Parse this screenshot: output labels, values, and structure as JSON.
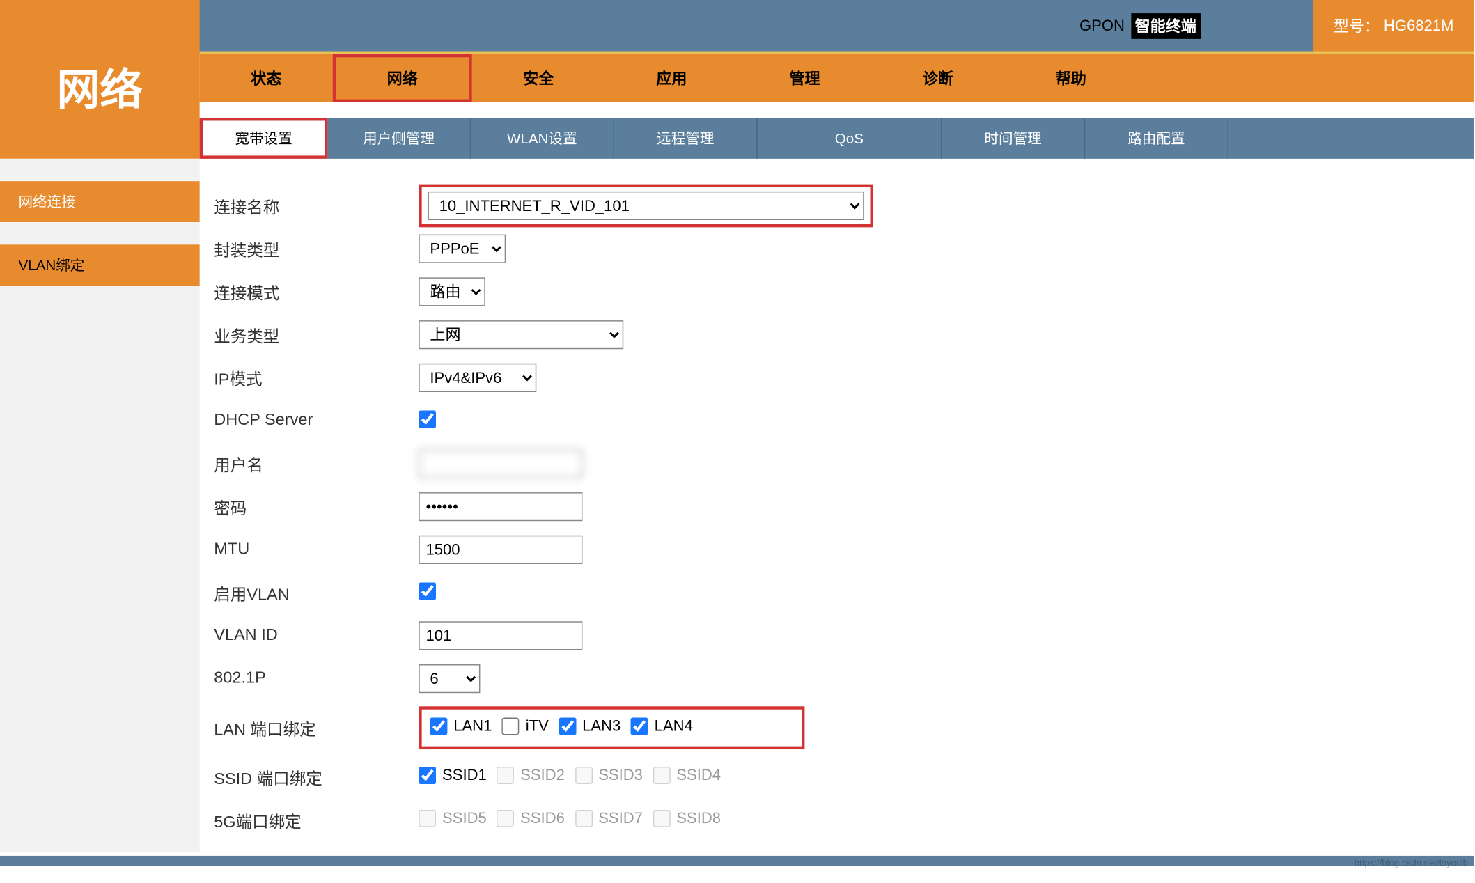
{
  "header": {
    "device_prefix": "GPON",
    "device_cn": "智能终端",
    "model_label": "型号：",
    "model_value": "HG6821M"
  },
  "page_title": "网络",
  "main_tabs": [
    "状态",
    "网络",
    "安全",
    "应用",
    "管理",
    "诊断",
    "帮助"
  ],
  "main_active": 1,
  "sub_tabs": [
    "宽带设置",
    "用户侧管理",
    "WLAN设置",
    "远程管理",
    "QoS",
    "时间管理",
    "路由配置"
  ],
  "sub_active": 0,
  "sidebar": [
    {
      "label": "网络连接",
      "active": true
    },
    {
      "label": "VLAN绑定",
      "active": false
    }
  ],
  "form": {
    "conn_name_label": "连接名称",
    "conn_name_value": "10_INTERNET_R_VID_101",
    "encap_label": "封装类型",
    "encap_value": "PPPoE",
    "conn_mode_label": "连接模式",
    "conn_mode_value": "路由",
    "biz_type_label": "业务类型",
    "biz_type_value": "上网",
    "ip_mode_label": "IP模式",
    "ip_mode_value": "IPv4&IPv6",
    "dhcp_label": "DHCP Server",
    "dhcp_checked": true,
    "username_label": "用户名",
    "username_value": "",
    "password_label": "密码",
    "password_value": "••••••",
    "mtu_label": "MTU",
    "mtu_value": "1500",
    "vlan_enable_label": "启用VLAN",
    "vlan_enable_checked": true,
    "vlan_id_label": "VLAN ID",
    "vlan_id_value": "101",
    "p8021_label": "802.1P",
    "p8021_value": "6",
    "lan_bind_label": "LAN 端口绑定",
    "lan_ports": [
      {
        "label": "LAN1",
        "checked": true
      },
      {
        "label": "iTV",
        "checked": false
      },
      {
        "label": "LAN3",
        "checked": true
      },
      {
        "label": "LAN4",
        "checked": true
      }
    ],
    "ssid_bind_label": "SSID 端口绑定",
    "ssid_ports": [
      {
        "label": "SSID1",
        "checked": true,
        "disabled": false
      },
      {
        "label": "SSID2",
        "checked": false,
        "disabled": true
      },
      {
        "label": "SSID3",
        "checked": false,
        "disabled": true
      },
      {
        "label": "SSID4",
        "checked": false,
        "disabled": true
      }
    ],
    "ssid5g_label": "5G端口绑定",
    "ssid5g_ports": [
      {
        "label": "SSID5",
        "checked": false,
        "disabled": true
      },
      {
        "label": "SSID6",
        "checked": false,
        "disabled": true
      },
      {
        "label": "SSID7",
        "checked": false,
        "disabled": true
      },
      {
        "label": "SSID8",
        "checked": false,
        "disabled": true
      }
    ]
  },
  "watermark": "https://blog.csdn.net/loyoclb"
}
